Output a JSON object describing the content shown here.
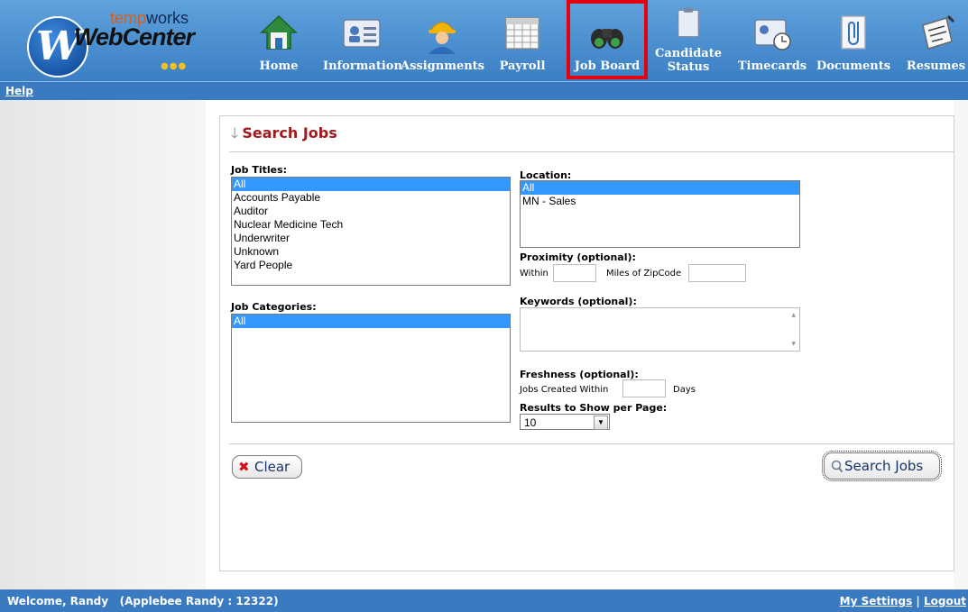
{
  "logo": {
    "line1_a": "temp",
    "line1_b": "works",
    "line2": "WebCenter",
    "mark": "W"
  },
  "nav": [
    {
      "label": "Home",
      "icon": "home-icon"
    },
    {
      "label": "Information",
      "icon": "id-card-icon"
    },
    {
      "label": "Assignments",
      "icon": "worker-icon"
    },
    {
      "label": "Payroll",
      "icon": "calendar-icon"
    },
    {
      "label": "Job Board",
      "icon": "binoculars-icon"
    },
    {
      "label": "Candidate Status",
      "icon": "clipboard-icon"
    },
    {
      "label": "Timecards",
      "icon": "timecard-icon"
    },
    {
      "label": "Documents",
      "icon": "paperclip-icon"
    },
    {
      "label": "Resumes",
      "icon": "resume-icon"
    }
  ],
  "help_label": "Help",
  "search": {
    "title": "Search Jobs",
    "job_titles_label": "Job Titles:",
    "job_titles": [
      "All",
      "Accounts Payable",
      "Auditor",
      "Nuclear Medicine Tech",
      "Underwriter",
      "Unknown",
      "Yard People"
    ],
    "job_categories_label": "Job Categories:",
    "job_categories": [
      "All"
    ],
    "location_label": "Location:",
    "locations": [
      "All",
      "MN - Sales"
    ],
    "proximity_label": "Proximity (optional):",
    "within_label": "Within",
    "miles_label": "Miles of ZipCode",
    "keywords_label": "Keywords (optional):",
    "freshness_label": "Freshness (optional):",
    "jobs_created_label": "Jobs Created Within",
    "days_label": "Days",
    "results_label": "Results to Show per Page:",
    "results_value": "10",
    "clear_label": "Clear",
    "search_label": "Search Jobs"
  },
  "footer": {
    "welcome": "Welcome, Randy   (Applebee Randy : 12322)",
    "settings": "My Settings",
    "separator": "|",
    "logout": "Logout"
  },
  "colors": {
    "header": "#3b7fc4",
    "title": "#a1191d",
    "selection": "#3399ff",
    "active_outline": "#e3000f"
  }
}
